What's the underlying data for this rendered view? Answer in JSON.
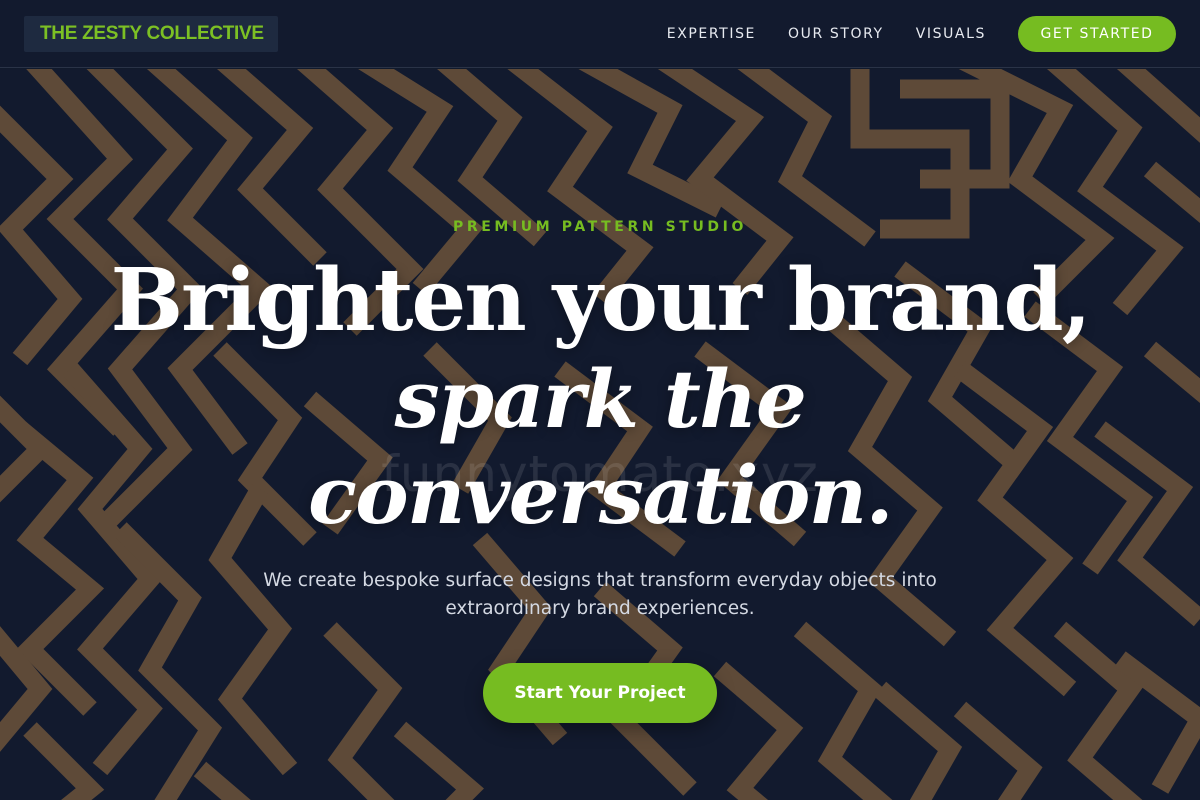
{
  "nav": {
    "brand": "THE ZESTY COLLECTIVE",
    "links": [
      {
        "label": "EXPERTISE"
      },
      {
        "label": "OUR STORY"
      },
      {
        "label": "VISUALS"
      }
    ],
    "cta_label": "GET STARTED"
  },
  "hero": {
    "eyebrow": "PREMIUM PATTERN STUDIO",
    "headline_line1": "Brighten your brand,",
    "headline_line2": "spark the",
    "headline_line3": "conversation.",
    "watermark": "funnytomato.xyz",
    "subtext": "We create bespoke surface designs that transform everyday objects into extraordinary brand experiences.",
    "cta_label": "Start Your Project"
  },
  "colors": {
    "accent": "#76bc21",
    "nav_background": "#121a2e",
    "hero_background": "#121a2e",
    "pattern_stroke": "#5e4a38",
    "text_primary": "#ffffff"
  }
}
